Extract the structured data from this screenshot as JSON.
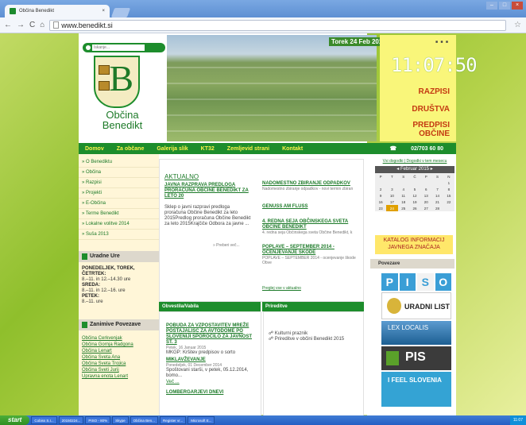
{
  "browser": {
    "tab_title": "Občina Benedikt",
    "tab_close": "×",
    "url": "www.benedikt.si",
    "nav": {
      "back": "←",
      "forward": "→",
      "reload": "C",
      "home": "⌂"
    },
    "window_controls": [
      "–",
      "□",
      "×"
    ]
  },
  "header": {
    "search_placeholder": "Iskanje...",
    "crest_name_line1": "Občina",
    "crest_name_line2": "Benedikt",
    "crest_letter": "B",
    "date": "Torek 24 Feb 2015",
    "clock": "11:07:50",
    "links": [
      "RAZPISI",
      "DRUŠTVA",
      "PREDPISI",
      "OBČINE"
    ]
  },
  "menu": {
    "items": [
      "Domov",
      "Za občane",
      "Galerija slik",
      "KT32",
      "Zemljevid strani",
      "Kontakt"
    ],
    "phone": "02/703 60 80"
  },
  "leftnav": {
    "items": [
      "» O Benediktu",
      "» Občina",
      "» Razpisi",
      "» Projekti",
      "» E-Občina",
      "» Terme Benedikt",
      "» Lokalne volitve 2014",
      "» Suša 2013"
    ],
    "hours_header": "Uradne Ure",
    "hours": [
      {
        "day": "PONEDELJEK, TOREK, ČETRTEK:",
        "time": "8.–11. in 12.–14.30 ure"
      },
      {
        "day": "SREDA:",
        "time": "8.–11. in 12.–16. ure"
      },
      {
        "day": "PETEK:",
        "time": "8.–11. ure"
      }
    ],
    "links_header": "Zanimive Povezave",
    "links": [
      "Občina Cerkvenjak",
      "Občina Gornja Radgona",
      "Občina Lenart",
      "Občina Sveta Ana",
      "Občina Sveta Trojica",
      "Občina Sveti Jurij",
      "Upravna enota Lenart"
    ]
  },
  "main": {
    "aktualno_title": "AKTUALNO",
    "lead_title": "JAVNA RAZPRAVA PREDLOGA PRORAČUNA OBČINE BENEDIKT ZA LETO 20",
    "lead_body": "Sklep o javni razpravi predloga proračuna Občine Benedikt za leto 2015Predlog proračuna Občine Benedikt za leto 2015Krajčiče Odbora za javne ...",
    "more": "» Preberi več...",
    "side_news": [
      {
        "title": "NADOMESTNO ZBIRANJE ODPADKOV",
        "body": "Nadomestno zbiranje odpadkov - novi termin zbiran"
      },
      {
        "title": "GENUSS AM FLUSS",
        "body": ""
      },
      {
        "title": "4. REDNA SEJA OBČINSKEGA SVETA OBČINE BENEDIKT",
        "body": "4. redna seja Občinskega sveta Občine Benedikt, k"
      },
      {
        "title": "POPLAVE – SEPTEMBER 2014 - OCENJEVANJE ŠKODE",
        "body": "POPLAVE – SEPTEMBER 2014 - ocenjevanje škode Obve"
      }
    ],
    "all_news": "Preglej vse v aktualno",
    "bar_left": "Obvestila/Vabila",
    "bar_right": "Prireditve",
    "obv": [
      {
        "title": "POBUDA ZA VZPOSTAVITEV MREŽE POSTAJALIŠČ ZA AVTODOME PO SLOVENIJI SPOROČILO ZA JAVNOST ŠT. 3",
        "date": "Petek, 16 Januar 2015",
        "body": "MKGP: Kršitev predpisov o sorto"
      },
      {
        "title": "MIKLAVŽEVANJE",
        "date": "Ponedeljek, 01 December 2014",
        "body": "Spoštovani starši, v petek, 05.12.2014, bomo..."
      },
      {
        "title": "LOMBERGARJEVI DNEVI",
        "date": "",
        "body": ""
      }
    ],
    "obv_more": "Več ...",
    "prir": [
      "Kulturni praznik",
      "Prireditve v občini Benedikt 2015"
    ]
  },
  "right": {
    "cal_links": "Vsi dogodki  |  Dogodki v tem mesecu",
    "cal_month": "Februar 2015",
    "cal_days": [
      "P",
      "T",
      "S",
      "Č",
      "P",
      "S",
      "N"
    ],
    "cal_rows": [
      [
        "",
        "",
        "",
        "",
        "",
        "",
        "1"
      ],
      [
        "2",
        "3",
        "4",
        "5",
        "6",
        "7",
        "8"
      ],
      [
        "9",
        "10",
        "11",
        "12",
        "13",
        "14",
        "15"
      ],
      [
        "16",
        "17",
        "18",
        "19",
        "20",
        "21",
        "22"
      ],
      [
        "23",
        "24",
        "25",
        "26",
        "27",
        "28",
        ""
      ]
    ],
    "katalog": "KATALOG INFORMACIJ JAVNEGA ZNAČAJA",
    "povezave": "Povezave",
    "piso": [
      "P",
      "I",
      "S",
      "O"
    ],
    "ul": "URADNI LIST",
    "lex": "LEX LOCALIS",
    "pis": "PIS",
    "ifs": "I FEEL SLOVENIA"
  },
  "taskbar": {
    "start": "start",
    "items": [
      "Cobiss S.I...",
      "20150224...",
      "PISO - 80%",
      "Skype",
      "Občina Ben...",
      "Register vr...",
      "Microsoft E..."
    ],
    "tray": "11:07"
  }
}
